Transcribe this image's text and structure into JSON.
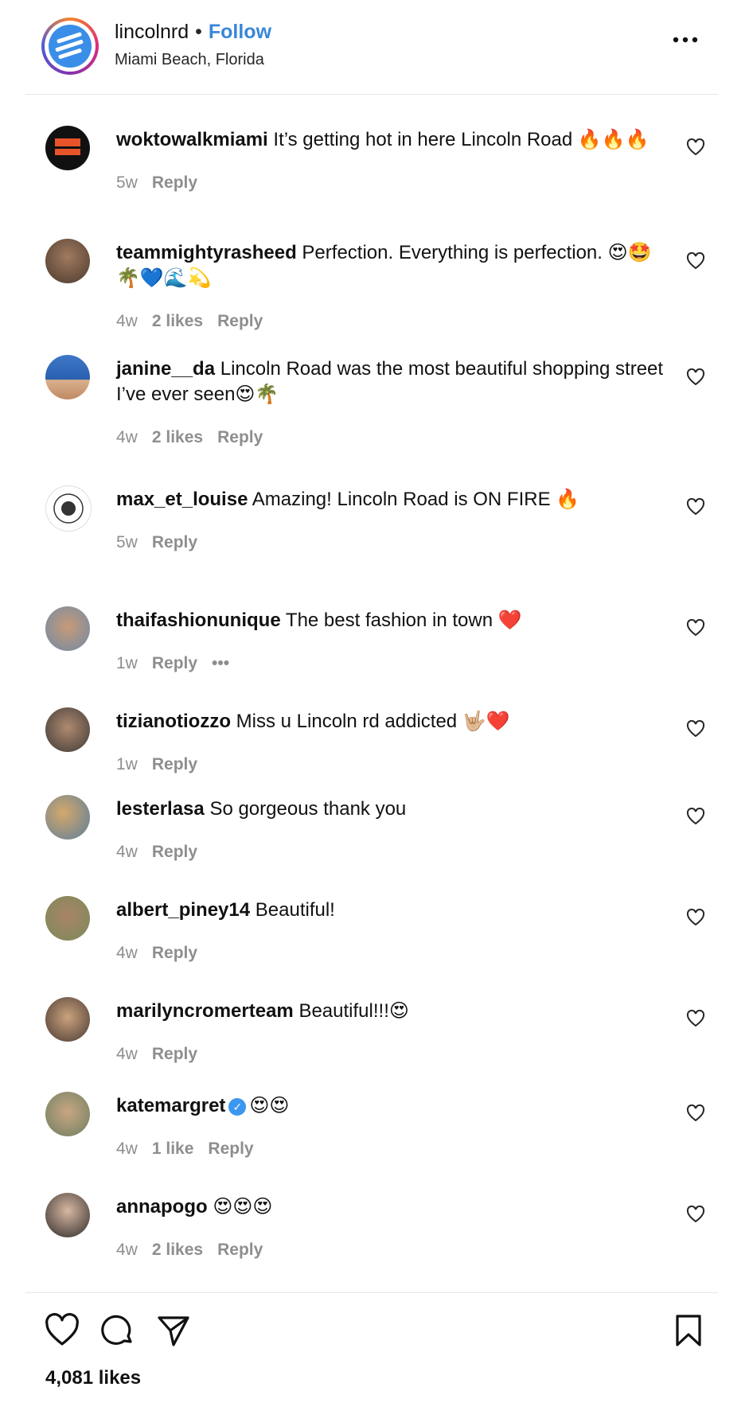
{
  "header": {
    "username": "lincolnrd",
    "separator": "•",
    "follow_label": "Follow",
    "location": "Miami Beach, Florida"
  },
  "comments": [
    {
      "user": "woktowalkmiami",
      "text": "It’s getting hot in here Lincoln Road 🔥🔥🔥",
      "time": "5w",
      "likes": "",
      "reply": "Reply"
    },
    {
      "user": "teammightyrasheed",
      "text": "Perfection. Everything is perfection. 😍🤩🌴💙🌊💫",
      "time": "4w",
      "likes": "2 likes",
      "reply": "Reply"
    },
    {
      "user": "janine__da",
      "text": "Lincoln Road was the most beautiful shopping street I’ve ever seen😍🌴",
      "time": "4w",
      "likes": "2 likes",
      "reply": "Reply"
    },
    {
      "user": "max_et_louise",
      "text": "Amazing! Lincoln Road is ON FIRE 🔥",
      "time": "5w",
      "likes": "",
      "reply": "Reply"
    },
    {
      "user": "thaifashionunique",
      "text": "The best fashion in town ❤️",
      "time": "1w",
      "likes": "",
      "reply": "Reply",
      "more": "•••"
    },
    {
      "user": "tizianotiozzo",
      "text": "Miss u Lincoln rd addicted 🤟🏼❤️",
      "time": "1w",
      "likes": "",
      "reply": "Reply"
    },
    {
      "user": "lesterlasa",
      "text": "So gorgeous thank you",
      "time": "4w",
      "likes": "",
      "reply": "Reply"
    },
    {
      "user": "albert_piney14",
      "text": "Beautiful!",
      "time": "4w",
      "likes": "",
      "reply": "Reply"
    },
    {
      "user": "marilyncromerteam",
      "text": "Beautiful!!!😍",
      "time": "4w",
      "likes": "",
      "reply": "Reply"
    },
    {
      "user": "katemargret",
      "text": "😍😍",
      "time": "4w",
      "likes": "1 like",
      "reply": "Reply",
      "verified": true
    },
    {
      "user": "annapogo",
      "text": "😍😍😍",
      "time": "4w",
      "likes": "2 likes",
      "reply": "Reply"
    }
  ],
  "footer": {
    "likes_count": "4,081 likes"
  },
  "colors": {
    "follow_blue": "#3a86d8",
    "meta_gray": "#8e8e8e",
    "divider": "#e6e6e6"
  },
  "icons": [
    "more-options-icon",
    "heart-icon",
    "comment-icon",
    "share-icon",
    "bookmark-icon",
    "verified-badge-icon"
  ]
}
